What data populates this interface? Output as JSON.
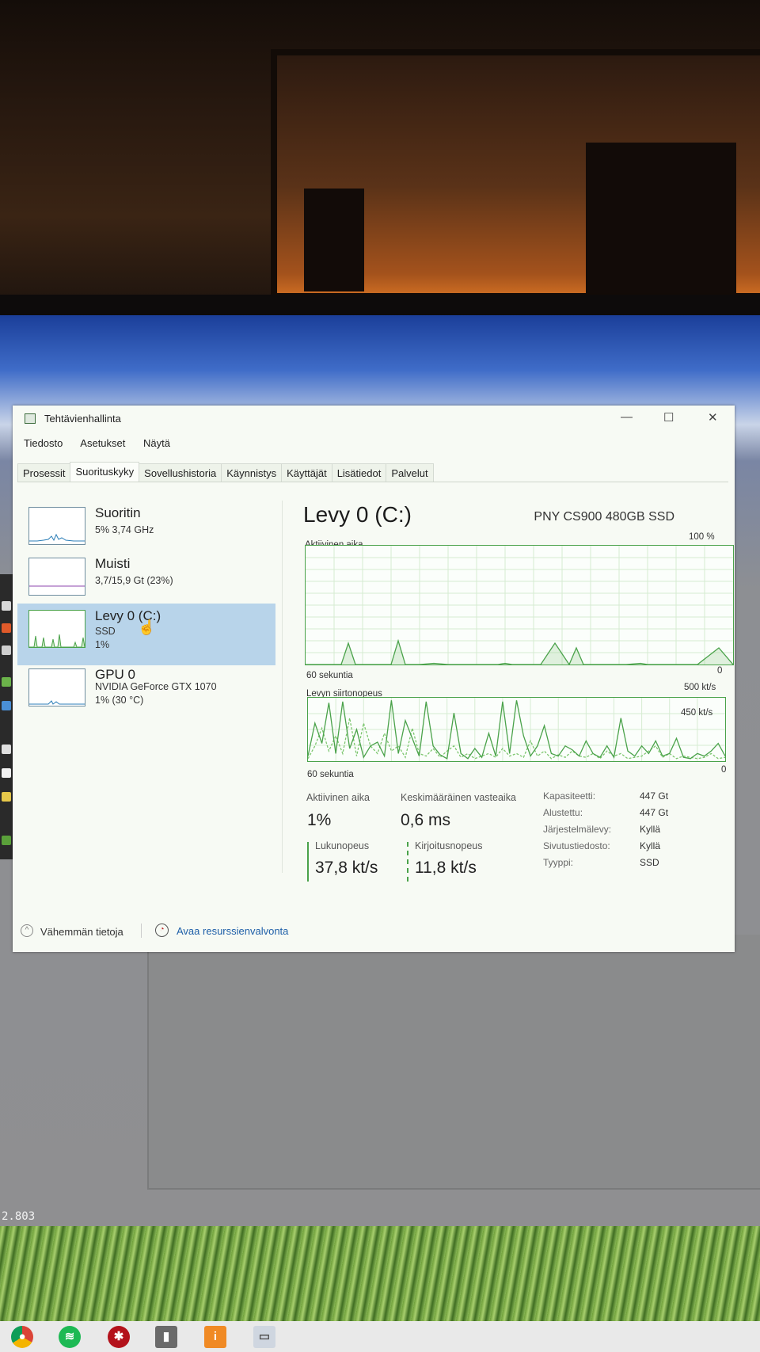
{
  "window": {
    "title": "Tehtävienhallinta",
    "minimize": "—",
    "maximize": "☐",
    "close": "✕"
  },
  "menu": [
    "Tiedosto",
    "Asetukset",
    "Näytä"
  ],
  "tabs": [
    "Prosessit",
    "Suorituskyky",
    "Sovellushistoria",
    "Käynnistys",
    "Käyttäjät",
    "Lisätiedot",
    "Palvelut"
  ],
  "active_tab": "Suorituskyky",
  "sidebar": [
    {
      "name": "Suoritin",
      "line1": "5% 3,74 GHz",
      "line2": ""
    },
    {
      "name": "Muisti",
      "line1": "3,7/15,9 Gt (23%)",
      "line2": ""
    },
    {
      "name": "Levy 0 (C:)",
      "line1": "SSD",
      "line2": "1%"
    },
    {
      "name": "GPU 0",
      "line1": "NVIDIA GeForce GTX 1070",
      "line2": "1% (30 °C)"
    }
  ],
  "selected_item": "Levy 0 (C:)",
  "main": {
    "title": "Levy 0 (C:)",
    "model": "PNY CS900 480GB SSD",
    "graph1": {
      "label": "Aktiivinen aika",
      "max_label": "100 %",
      "time_label": "60 sekuntia",
      "min_label": "0"
    },
    "graph2": {
      "label": "Levyn siirtonopeus",
      "max_label": "500 kt/s",
      "ref_label": "450 kt/s",
      "time_label": "60 sekuntia",
      "min_label": "0"
    },
    "stats": {
      "active_label": "Aktiivinen aika",
      "active_value": "1%",
      "response_label": "Keskimääräinen vasteaika",
      "response_value": "0,6 ms",
      "read_label": "Lukunopeus",
      "read_value": "37,8 kt/s",
      "write_label": "Kirjoitusnopeus",
      "write_value": "11,8 kt/s"
    },
    "properties": [
      {
        "key": "Kapasiteetti:",
        "value": "447 Gt"
      },
      {
        "key": "Alustettu:",
        "value": "447 Gt"
      },
      {
        "key": "Järjestelmälevy:",
        "value": "Kyllä"
      },
      {
        "key": "Sivutustiedosto:",
        "value": "Kyllä"
      },
      {
        "key": "Tyyppi:",
        "value": "SSD"
      }
    ]
  },
  "footer": {
    "fewer_details": "Vähemmän tietoja",
    "open_resmon": "Avaa resurssienvalvonta"
  },
  "desktop": {
    "version_text": "2.803"
  },
  "taskbar_icons": [
    "chrome-icon",
    "spotify-icon",
    "app-icon",
    "game-icon",
    "installer-icon",
    "photos-icon"
  ],
  "colors": {
    "graph_line": "#4aa24a",
    "selection": "#b8d4ea",
    "link": "#1e5fa8"
  },
  "chart_data": [
    {
      "type": "area",
      "title": "Aktiivinen aika",
      "xlabel": "60 sekuntia",
      "ylim": [
        0,
        100
      ],
      "x": [
        0,
        3,
        5,
        6,
        7,
        9,
        12,
        13,
        14,
        16,
        18,
        20,
        23,
        25,
        27,
        28,
        29,
        31,
        33,
        35,
        37,
        38,
        39,
        41,
        43,
        45,
        47,
        48,
        49,
        51,
        53,
        55,
        58,
        60
      ],
      "values": [
        0,
        0,
        0,
        18,
        0,
        0,
        0,
        20,
        0,
        0,
        1,
        0,
        0,
        0,
        0,
        1,
        0,
        0,
        0,
        18,
        0,
        14,
        0,
        0,
        0,
        0,
        1,
        0,
        0,
        0,
        0,
        0,
        14,
        0
      ]
    },
    {
      "type": "line",
      "title": "Levyn siirtonopeus",
      "xlabel": "60 sekuntia",
      "ylim": [
        0,
        500
      ],
      "x": [
        0,
        1,
        2,
        3,
        4,
        5,
        6,
        7,
        8,
        9,
        10,
        11,
        12,
        13,
        14,
        15,
        16,
        17,
        18,
        19,
        20,
        21,
        22,
        23,
        24,
        25,
        26,
        27,
        28,
        29,
        30,
        31,
        32,
        33,
        34,
        35,
        36,
        37,
        38,
        39,
        40,
        41,
        42,
        43,
        44,
        45,
        46,
        47,
        48,
        49,
        50,
        51,
        52,
        53,
        54,
        55,
        56,
        57,
        58,
        59,
        60
      ],
      "series": [
        {
          "values": [
            40,
            300,
            140,
            460,
            60,
            470,
            100,
            250,
            30,
            120,
            150,
            40,
            480,
            60,
            320,
            180,
            40,
            470,
            120,
            50,
            20,
            380,
            60,
            20,
            100,
            30,
            220,
            40,
            470,
            60,
            480,
            200,
            40,
            120,
            280,
            60,
            40,
            120,
            90,
            40,
            160,
            60,
            30,
            120,
            30,
            340,
            80,
            40,
            120,
            60,
            160,
            40,
            60,
            180,
            30,
            20,
            60,
            40,
            80,
            140,
            40
          ]
        },
        {
          "values": [
            20,
            120,
            260,
            80,
            200,
            60,
            340,
            40,
            300,
            120,
            60,
            220,
            80,
            120,
            30,
            260,
            60,
            40,
            100,
            30,
            80,
            120,
            30,
            60,
            20,
            40,
            60,
            30,
            100,
            40,
            60,
            30,
            160,
            40,
            80,
            20,
            50,
            30,
            80,
            40,
            30,
            60,
            20,
            80,
            40,
            60,
            20,
            30,
            40,
            80,
            120,
            30,
            60,
            20,
            40,
            30,
            20,
            30,
            60,
            20,
            30
          ]
        }
      ]
    }
  ]
}
